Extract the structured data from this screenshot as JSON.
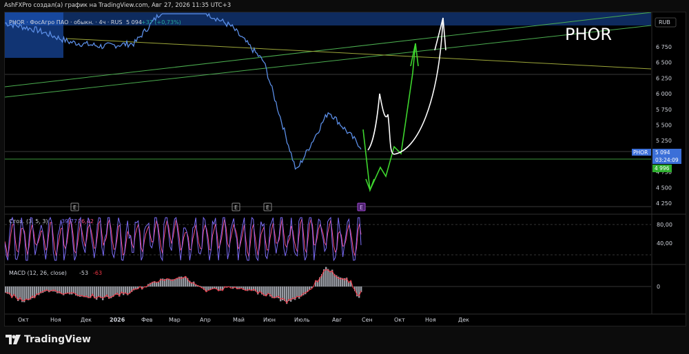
{
  "header": {
    "attribution": "AshFXPro создал(а) график на TradingView.com, Авг 27, 2026 11:35 UTC+3"
  },
  "legend": {
    "symbol_line": "PHOR · ФосАгро ПАО · обыкн. · 4ч · RUS",
    "last_price": "5 094",
    "change": "+37 (+0,73%)"
  },
  "watermark_ticker": "PHOR",
  "currency": "RUB",
  "price_axis": {
    "ticks": [
      "6 750",
      "6 500",
      "6 250",
      "6 000",
      "5 750",
      "5 500",
      "5 250",
      "5 000",
      "4 750",
      "4 500",
      "4 250"
    ]
  },
  "price_tags": {
    "symbol": "PHOR",
    "price": "5 094",
    "countdown": "03:24:09",
    "level": "4 996"
  },
  "time_axis": {
    "labels": [
      "Окт",
      "Ноя",
      "Дек",
      "2026",
      "Фев",
      "Мар",
      "Апр",
      "Май",
      "Июн",
      "Июль",
      "Авг",
      "Сен",
      "Окт",
      "Ноя",
      "Дек"
    ]
  },
  "earnings_markers": [
    "E",
    "E",
    "E",
    "E"
  ],
  "stoch": {
    "title": "Стох. (3, 5, 3)",
    "k_value": "39,77",
    "d_value": "26,42",
    "axis_ticks": [
      "80,00",
      "40,00"
    ],
    "k_color": "#7b6cf6",
    "d_color": "#ff4f8b"
  },
  "macd": {
    "title": "MACD (12, 26, close)",
    "macd_value": "-53",
    "signal_value": "-63",
    "axis_ticks": [
      "0"
    ],
    "signal_color": "#f23645",
    "hist_color": "#b2b5be"
  },
  "colors": {
    "price_line": "#5b8ee6",
    "zone": "#1f5fd1",
    "projection_green": "#3ed62e",
    "projection_white": "#ffffff",
    "trendline_green": "#4caf50",
    "trendline_olive": "#9ea83a"
  },
  "footer": {
    "brand": "TradingView"
  },
  "chart_data": {
    "type": "line",
    "x": [
      "Окт",
      "Ноя",
      "Дек",
      "2026",
      "Фев",
      "Мар",
      "Апр",
      "Май",
      "Июн",
      "Июль",
      "Авг",
      "Сен"
    ],
    "series": [
      {
        "values": [
          6850,
          6750,
          6580,
          6520,
          6560,
          7100,
          7050,
          6800,
          6300,
          4750,
          5600,
          5094
        ]
      }
    ],
    "ylim": [
      4150,
      7000
    ],
    "ylabel": "",
    "xlabel": "",
    "last_value": 5094,
    "horizontal_levels": [
      4996
    ]
  }
}
